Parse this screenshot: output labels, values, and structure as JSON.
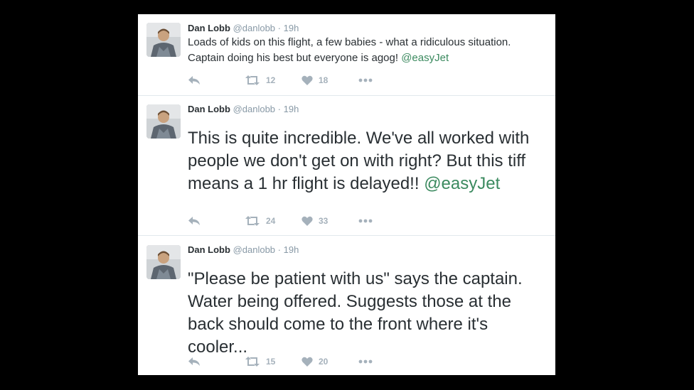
{
  "tweets": [
    {
      "name": "Dan Lobb",
      "handle": "@danlobb",
      "separator": "·",
      "time": "19h",
      "text": "Loads of kids on this flight, a few babies - what a ridiculous situation. Captain doing his best but everyone is agog! ",
      "mention": "@easyJet",
      "retweets": "12",
      "likes": "18"
    },
    {
      "name": "Dan Lobb",
      "handle": "@danlobb",
      "separator": "·",
      "time": "19h",
      "text": "This is quite incredible. We've all worked with people we don't get on with right? But this tiff means a 1 hr flight is delayed!! ",
      "mention": "@easyJet",
      "retweets": "24",
      "likes": "33"
    },
    {
      "name": "Dan Lobb",
      "handle": "@danlobb",
      "separator": "·",
      "time": "19h",
      "text": "\"Please be patient with us\" says the captain. Water being offered. Suggests those at the back should come to the front where it's cooler...",
      "mention": "",
      "retweets": "15",
      "likes": "20"
    }
  ],
  "icons": {
    "reply": "reply-icon",
    "retweet": "retweet-icon",
    "like": "heart-icon",
    "more": "more-icon"
  },
  "colors": {
    "text": "#292f33",
    "secondary": "#8899a6",
    "mention": "#3b8a5f",
    "action": "#a5b1bb"
  }
}
